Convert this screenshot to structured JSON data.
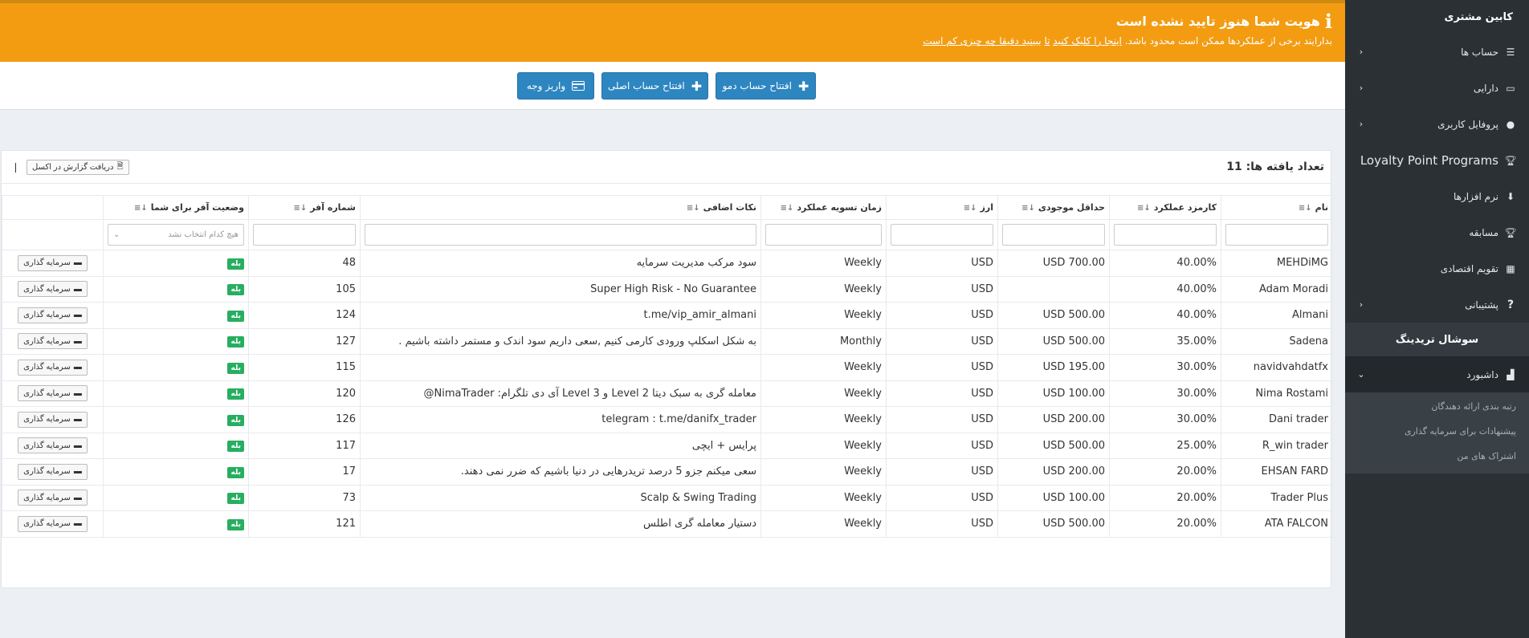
{
  "alert": {
    "title": "هویت شما هنوز تایید نشده است",
    "text": "بدارایند برخی از عملکردها ممکن است محدود باشد.",
    "link1": "اینجا را کلیک کنید",
    "link_mid": "تا",
    "link2": "ببینید دقیقا چه چیزی کم است"
  },
  "actions": {
    "demo": "افتتاح حساب دمو",
    "main": "افتتاح حساب اصلی",
    "deposit": "واریز وجه"
  },
  "sidebar": {
    "title": "کابین مشتری",
    "items": [
      {
        "label": "حساب ها"
      },
      {
        "label": "دارایی"
      },
      {
        "label": "پروفایل کاربری"
      },
      {
        "label": "Loyalty Point Programs"
      },
      {
        "label": "نرم افزارها"
      },
      {
        "label": "مسابقه"
      },
      {
        "label": "تقویم اقتصادی"
      },
      {
        "label": "پشتیبانی"
      }
    ],
    "section": "سوشال تریدینگ",
    "dashboard": "داشبورد",
    "subitems": [
      {
        "label": "رتبه بندی ارائه دهندگان"
      },
      {
        "label": "پیشنهادات برای سرمایه گذاری"
      },
      {
        "label": "اشتراک های من"
      }
    ]
  },
  "panel": {
    "count_label": "تعداد یافته ها:",
    "count": "11",
    "excel": "دریافت گزارش در اکسل",
    "select_placeholder": "هیچ کدام انتخاب نشد"
  },
  "table": {
    "headers": [
      "نام",
      "کارمزد عملکرد",
      "حداقل موجودی",
      "ارز",
      "زمان تسویه عملکرد",
      "نکات اضافی",
      "شماره آفر",
      "وضعیت آفر برای شما"
    ],
    "yes": "بله",
    "invest": "سرمایه گذاری",
    "rows": [
      {
        "name": "MEHDiMG",
        "fee": "40.00%",
        "min": "USD 700.00",
        "cur": "USD",
        "period": "Weekly",
        "note": "سود مرکب مدیریت سرمایه",
        "offer": "48"
      },
      {
        "name": "Adam Moradi",
        "fee": "40.00%",
        "min": "",
        "cur": "USD",
        "period": "Weekly",
        "note": "Super High Risk - No Guarantee",
        "offer": "105"
      },
      {
        "name": "Almani",
        "fee": "40.00%",
        "min": "USD 500.00",
        "cur": "USD",
        "period": "Weekly",
        "note": "t.me/vip_amir_almani",
        "offer": "124"
      },
      {
        "name": "Sadena",
        "fee": "35.00%",
        "min": "USD 500.00",
        "cur": "USD",
        "period": "Monthly",
        "note": "به شکل اسکلپ ورودی کارمی کنیم ,سعی داریم سود اندک و مستمر داشته باشیم .",
        "offer": "127"
      },
      {
        "name": "navidvahdatfx",
        "fee": "30.00%",
        "min": "USD 195.00",
        "cur": "USD",
        "period": "Weekly",
        "note": "",
        "offer": "115"
      },
      {
        "name": "Nima Rostami",
        "fee": "30.00%",
        "min": "USD 100.00",
        "cur": "USD",
        "period": "Weekly",
        "note": "معامله گری به سبک دیتا Level 2 و Level 3 آی دی تلگرام: NimaTrader@",
        "offer": "120"
      },
      {
        "name": "Dani trader",
        "fee": "30.00%",
        "min": "USD 200.00",
        "cur": "USD",
        "period": "Weekly",
        "note": "telegram : t.me/danifx_trader",
        "offer": "126"
      },
      {
        "name": "R_win trader",
        "fee": "25.00%",
        "min": "USD 500.00",
        "cur": "USD",
        "period": "Weekly",
        "note": "پرایس + ایچی",
        "offer": "117"
      },
      {
        "name": "EHSAN FARD",
        "fee": "20.00%",
        "min": "USD 200.00",
        "cur": "USD",
        "period": "Weekly",
        "note": "سعی میکنم جزو 5 درصد تریدرهایی در دنیا باشیم که ضرر نمی دهند.",
        "offer": "17"
      },
      {
        "name": "Trader Plus",
        "fee": "20.00%",
        "min": "USD 100.00",
        "cur": "USD",
        "period": "Weekly",
        "note": "Scalp & Swing Trading",
        "offer": "73"
      },
      {
        "name": "ATA FALCON",
        "fee": "20.00%",
        "min": "USD 500.00",
        "cur": "USD",
        "period": "Weekly",
        "note": "دستیار معامله گری اطلس",
        "offer": "121"
      }
    ]
  }
}
